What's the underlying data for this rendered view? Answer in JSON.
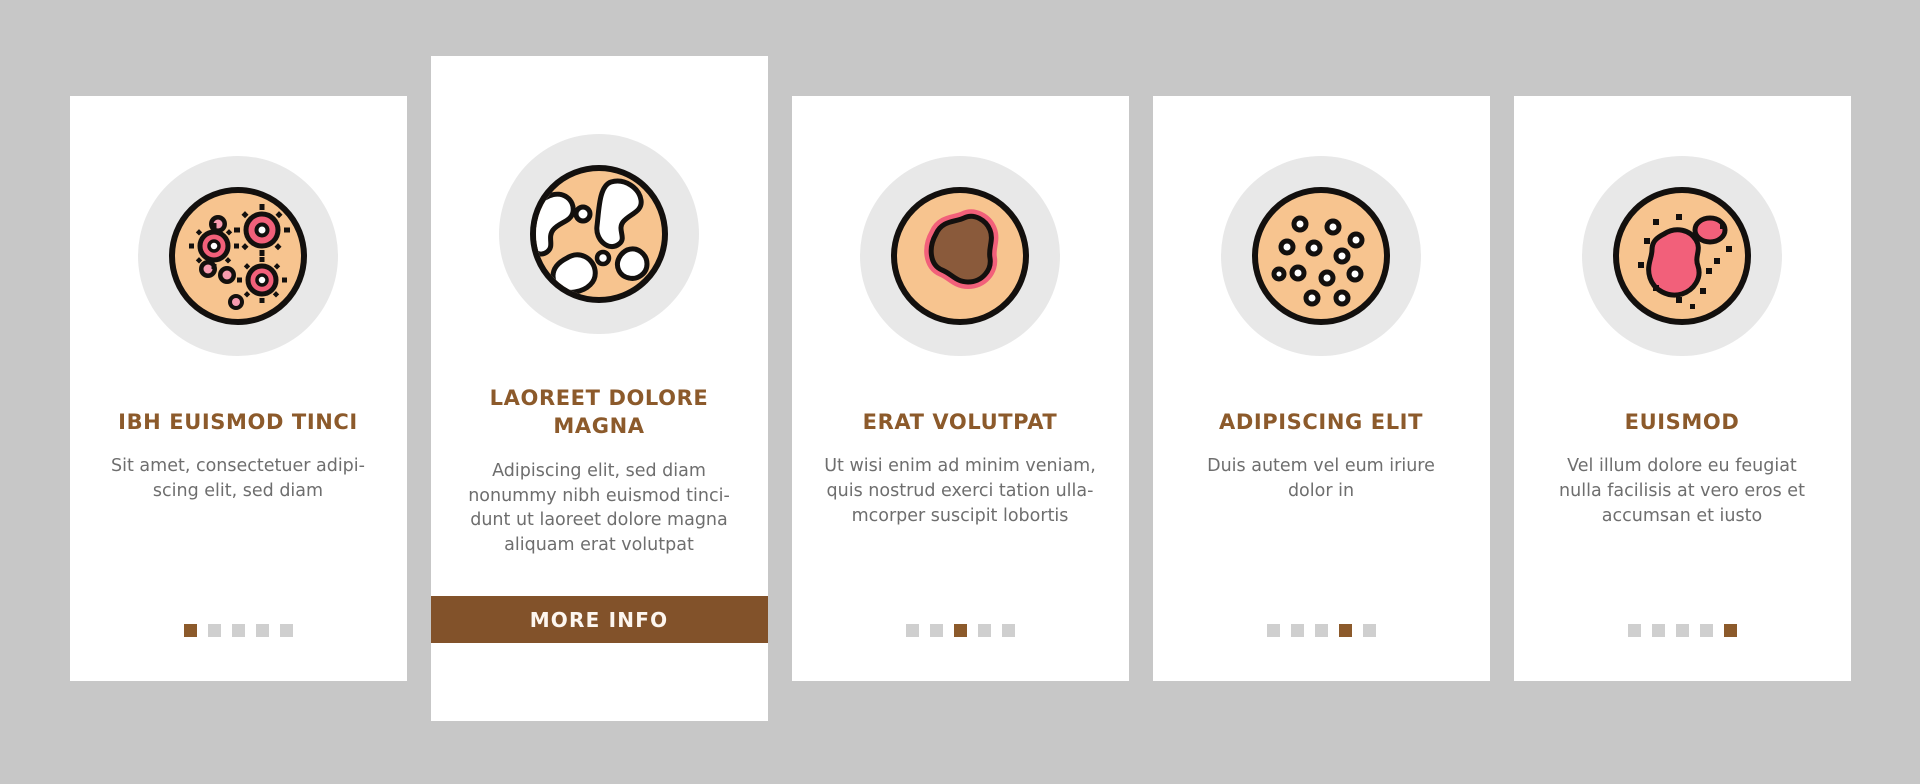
{
  "theme": {
    "background": "#c7c7c7",
    "card_background": "#ffffff",
    "accent": "#8c5a2b",
    "cta_background": "#82522a",
    "title_color": "#8c5a2b",
    "body_color": "#6e6e6e",
    "dot_inactive": "#cfcfcf",
    "icon_circle_background": "#e8e8e8",
    "dish_fill": "#f7c48f",
    "dish_stroke": "#13100e",
    "colony_pink": "#f2607a",
    "colony_brown": "#8a5a3b",
    "colony_white": "#ffffff"
  },
  "cards": [
    {
      "id": "card-1",
      "featured": false,
      "icon": "petri-dish-virus-colonies-icon",
      "title": "IBH EUISMOD TINCI",
      "body": "Sit amet, consectetuer adipi-\nscing elit, sed diam",
      "dots": {
        "count": 5,
        "active_index": 0
      }
    },
    {
      "id": "card-2",
      "featured": true,
      "icon": "petri-dish-mold-patches-icon",
      "title": "LAOREET DOLORE MAGNA",
      "body": "Adipiscing elit, sed diam\nnonummy nibh euismod tinci-\ndunt ut laoreet dolore magna\naliquam erat volutpat",
      "cta_label": "MORE INFO",
      "dots": null
    },
    {
      "id": "card-3",
      "featured": false,
      "icon": "petri-dish-single-blob-colony-icon",
      "title": "ERAT VOLUTPAT",
      "body": "Ut wisi enim ad minim veniam,\nquis nostrud exerci tation ulla-\nmcorper suscipit lobortis",
      "dots": {
        "count": 5,
        "active_index": 2
      }
    },
    {
      "id": "card-4",
      "featured": false,
      "icon": "petri-dish-bacteria-dots-icon",
      "title": "ADIPISCING ELIT",
      "body": "Duis autem vel eum iriure\ndolor in",
      "dots": {
        "count": 5,
        "active_index": 3
      }
    },
    {
      "id": "card-5",
      "featured": false,
      "icon": "petri-dish-pink-colony-spots-icon",
      "title": "EUISMOD",
      "body": "Vel illum dolore eu feugiat\nnulla facilisis at vero eros et\naccumsan et iusto",
      "dots": {
        "count": 5,
        "active_index": 4
      }
    }
  ]
}
